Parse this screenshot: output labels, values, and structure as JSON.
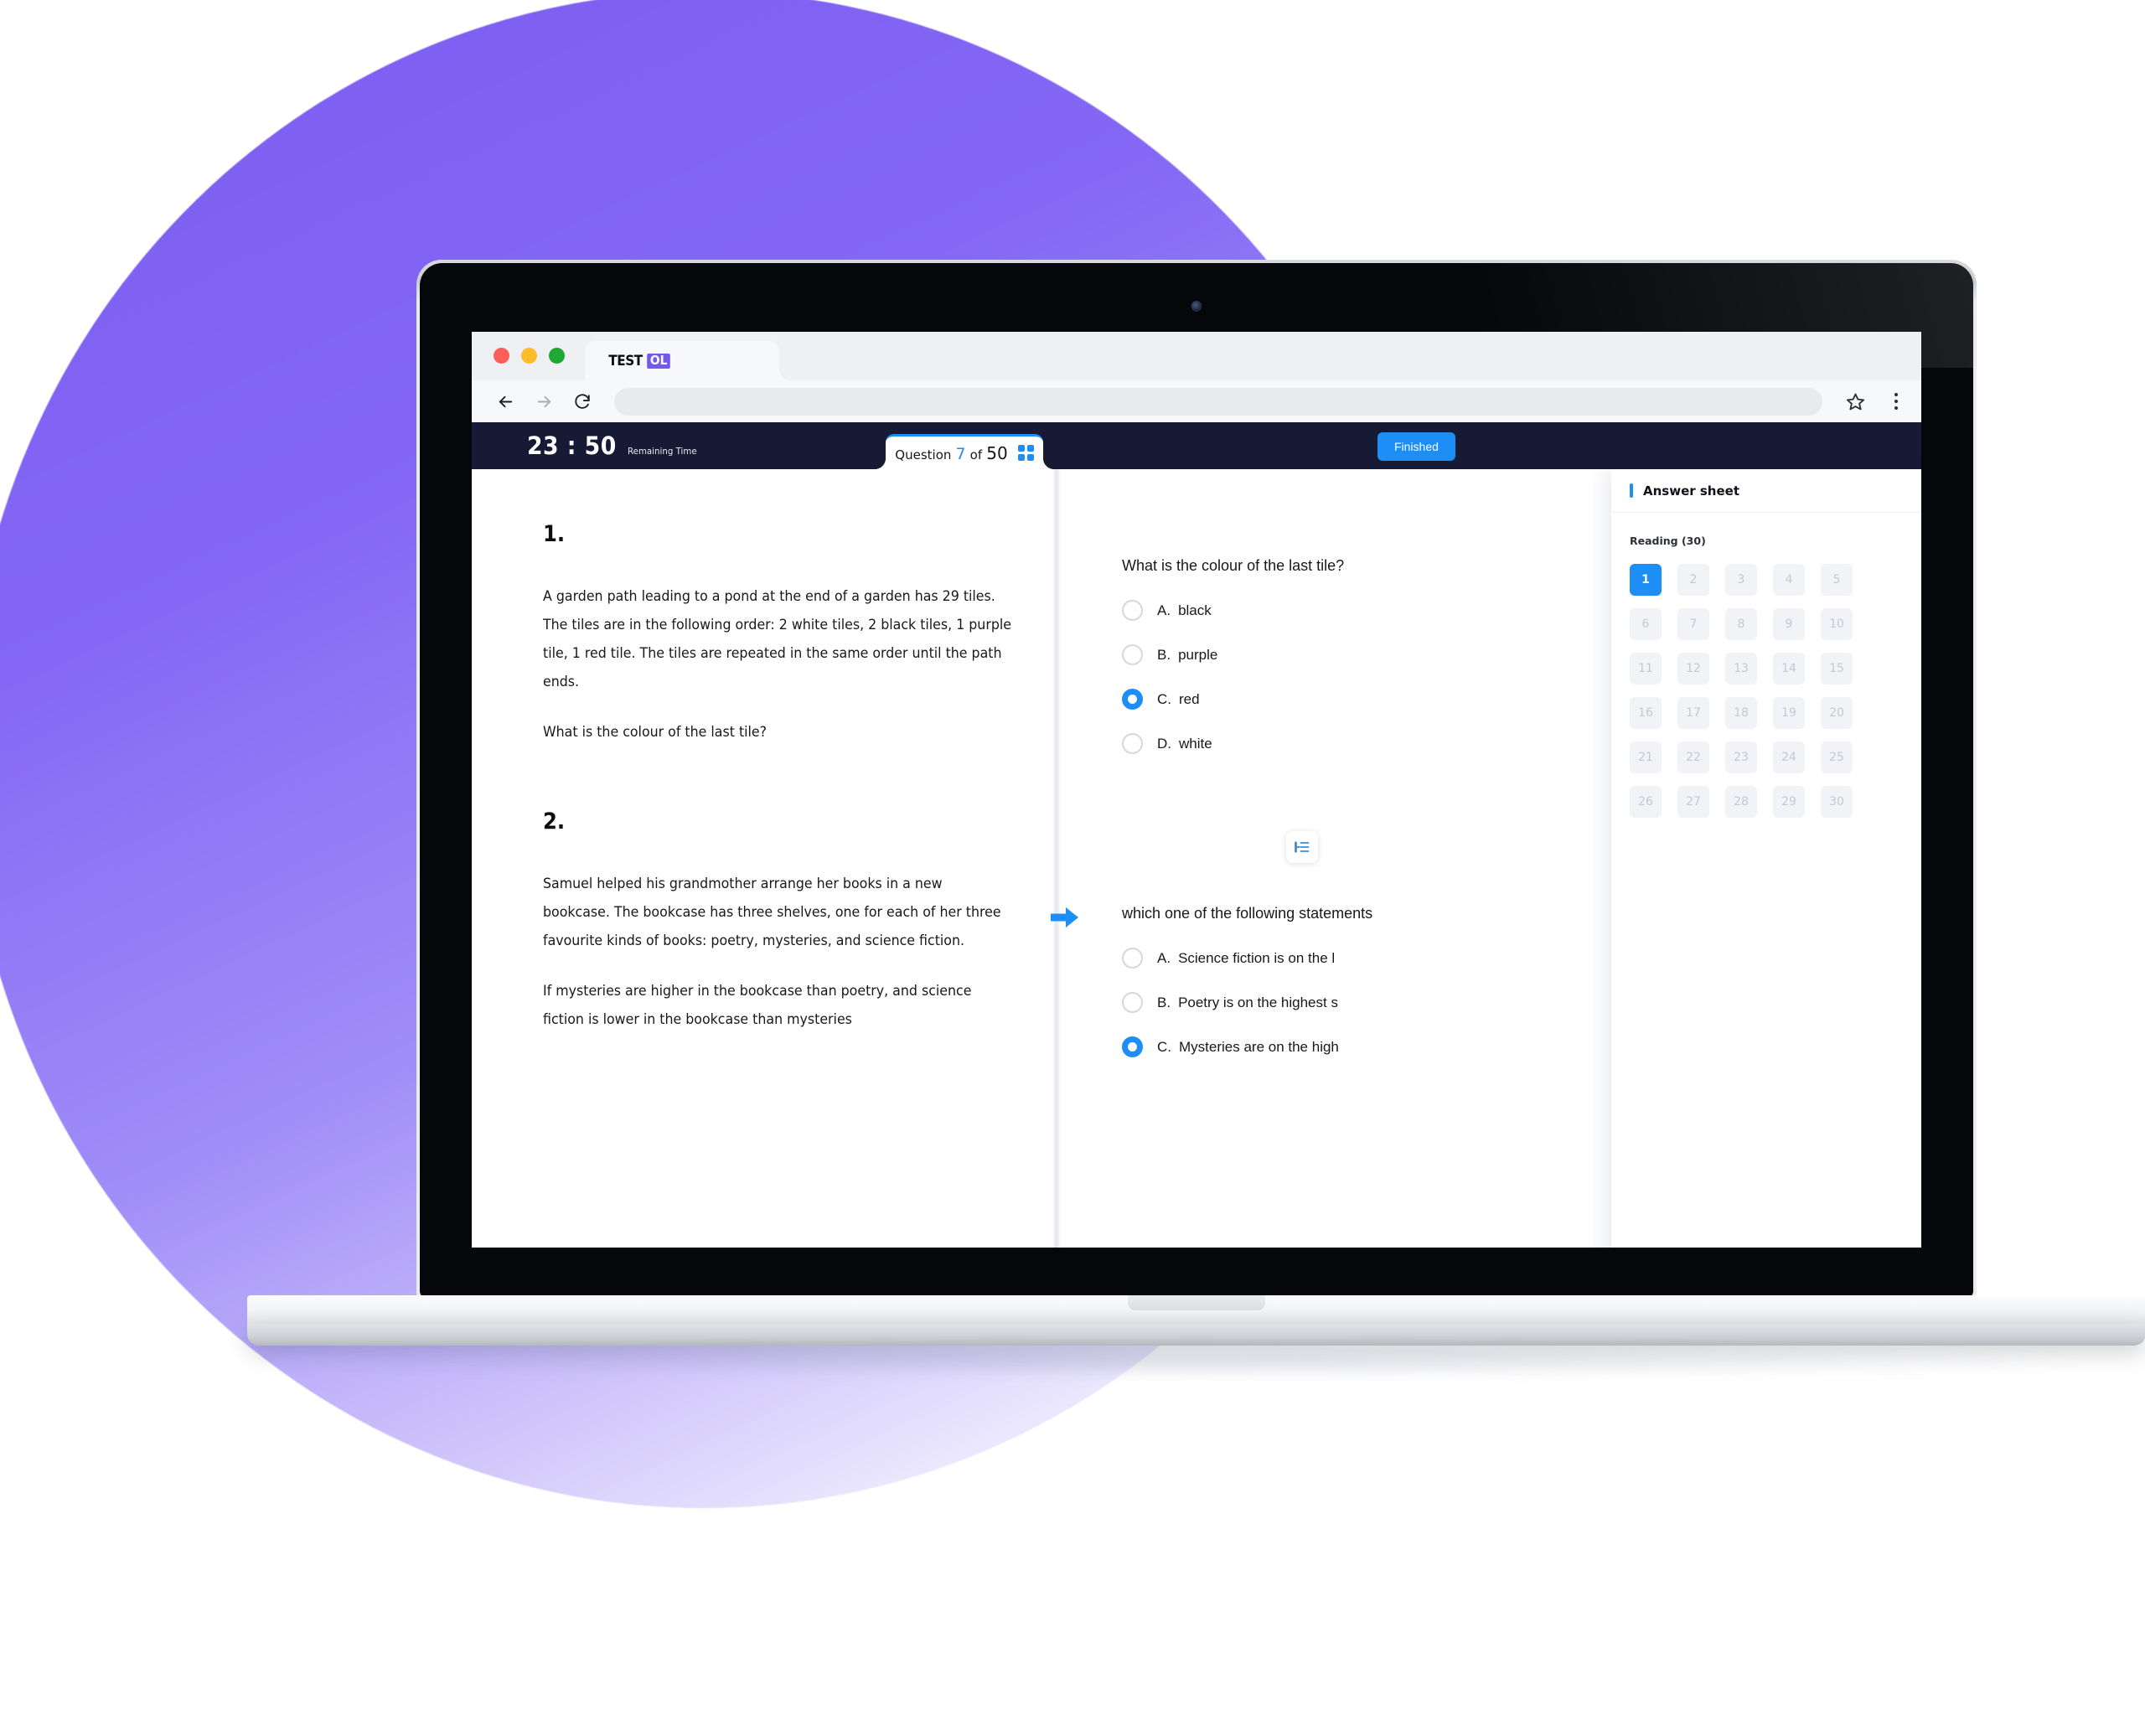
{
  "browser": {
    "tab_title": "TESTOL",
    "logo_text": "TEST",
    "logo_badge": "OL",
    "address_value": "",
    "address_placeholder": "",
    "back_icon": "back-arrow-icon",
    "forward_icon": "forward-arrow-icon",
    "reload_icon": "reload-icon",
    "bookmark_icon": "star-icon",
    "menu_icon": "kebab-menu-icon"
  },
  "appbar": {
    "timer_value": "23 : 50",
    "timer_label": "Remaining  Time",
    "question_prefix": "Question",
    "question_current": "7",
    "question_of": "of",
    "question_total": "50",
    "grid_icon": "grid-view-icon",
    "finished_label": "Finished",
    "accent_color": "#1d8ef5",
    "bar_color": "#161a35"
  },
  "left_pane": {
    "questions": [
      {
        "number": "1.",
        "paragraphs": [
          "A garden path leading to a pond at the end of a garden has 29 tiles. The tiles are in the following order: 2 white tiles, 2 black tiles, 1 purple tile, 1 red tile. The tiles are repeated in the same order until the path ends.",
          "What is the colour of the last tile?"
        ]
      },
      {
        "number": "2.",
        "paragraphs": [
          "Samuel helped his grandmother arrange her books in a new bookcase. The bookcase has three shelves, one for each of her three favourite kinds of books: poetry, mysteries, and science fiction.",
          "If mysteries are higher in the bookcase than poetry, and science fiction is lower in the bookcase than mysteries"
        ]
      }
    ]
  },
  "right_pane": {
    "blocks": [
      {
        "prompt": "What is the colour of the last tile?",
        "options": [
          {
            "letter": "A.",
            "text": "black",
            "selected": false
          },
          {
            "letter": "B.",
            "text": "purple",
            "selected": false
          },
          {
            "letter": "C.",
            "text": "red",
            "selected": true
          },
          {
            "letter": "D.",
            "text": "white",
            "selected": false
          }
        ]
      },
      {
        "prompt": "which one of the following statements",
        "options": [
          {
            "letter": "A.",
            "text": "Science fiction is on the l",
            "selected": false
          },
          {
            "letter": "B.",
            "text": "Poetry is on the highest s",
            "selected": false
          },
          {
            "letter": "C.",
            "text": "Mysteries are on the high",
            "selected": true
          }
        ]
      }
    ],
    "next_arrow_icon": "next-arrow-icon",
    "list_toggle_icon": "list-view-icon"
  },
  "answer_sheet": {
    "title": "Answer sheet",
    "section_label": "Reading (30)",
    "cells": [
      "1",
      "2",
      "3",
      "4",
      "5",
      "6",
      "7",
      "8",
      "9",
      "10",
      "11",
      "12",
      "13",
      "14",
      "15",
      "16",
      "17",
      "18",
      "19",
      "20",
      "21",
      "22",
      "23",
      "24",
      "25",
      "26",
      "27",
      "28",
      "29",
      "30"
    ],
    "active_cell": "1"
  }
}
